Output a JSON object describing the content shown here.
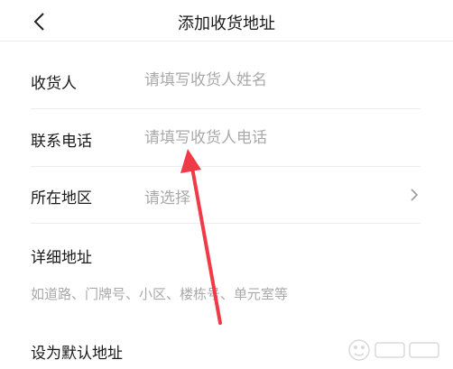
{
  "header": {
    "title": "添加收货地址",
    "back_icon": "chevron-left-icon"
  },
  "form": {
    "recipient": {
      "label": "收货人",
      "placeholder": "请填写收货人姓名"
    },
    "phone": {
      "label": "联系电话",
      "placeholder": "请填写收货人电话"
    },
    "region": {
      "label": "所在地区",
      "placeholder": "请选择",
      "icon": "chevron-right-icon"
    },
    "address": {
      "label": "详细地址",
      "placeholder": "如道路、门牌号、小区、楼栋号、单元室等"
    },
    "default": {
      "label": "设为默认地址"
    }
  },
  "annotation": {
    "color": "#f03a48",
    "icon": "red-arrow-icon"
  },
  "watermark": {
    "icon": "baidu-jingyan-watermark-icon"
  }
}
